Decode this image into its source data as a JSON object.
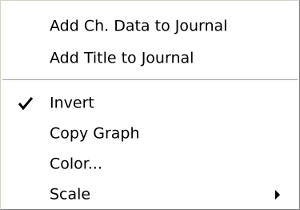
{
  "menu": {
    "items": [
      {
        "id": "add_ch_data",
        "label": "Add Ch. Data to Journal"
      },
      {
        "id": "add_title",
        "label": "Add Title to Journal"
      },
      {
        "id": "invert",
        "label": "Invert",
        "checked": true,
        "check_icon": "check-icon"
      },
      {
        "id": "copy_graph",
        "label": "Copy Graph"
      },
      {
        "id": "color",
        "label": "Color..."
      },
      {
        "id": "scale",
        "label": "Scale",
        "submenu_icon": "submenu-arrow-icon"
      }
    ],
    "colors": {
      "background": "#ffffff",
      "text": "#000000",
      "separator": "#a0a0a0"
    }
  }
}
